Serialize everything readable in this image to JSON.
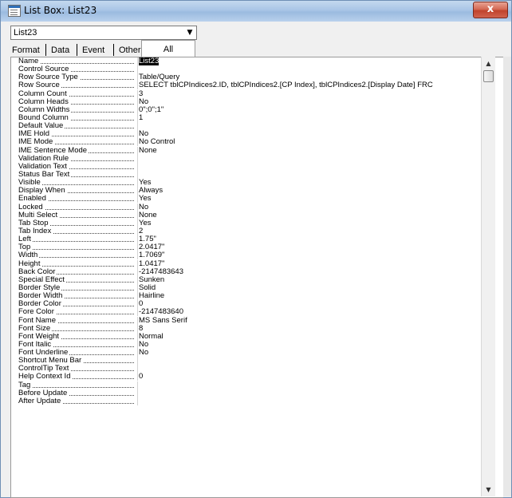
{
  "window": {
    "title": "List Box: List23",
    "close_glyph": "x"
  },
  "selector": {
    "value": "List23",
    "arrow_glyph": "▼"
  },
  "tabs": [
    {
      "label": "Format"
    },
    {
      "label": "Data"
    },
    {
      "label": "Event"
    },
    {
      "label": "Other"
    },
    {
      "label": "All",
      "active": true
    }
  ],
  "properties": [
    {
      "name": "Name",
      "value": "List23",
      "selected": true
    },
    {
      "name": "Control Source",
      "value": ""
    },
    {
      "name": "Row Source Type",
      "value": "Table/Query"
    },
    {
      "name": "Row Source",
      "value": "SELECT tblCPIndices2.ID, tblCPIndices2.[CP Index], tblCPIndices2.[Display Date] FRC"
    },
    {
      "name": "Column Count",
      "value": "3"
    },
    {
      "name": "Column Heads",
      "value": "No"
    },
    {
      "name": "Column Widths",
      "value": "0\";0\";1\""
    },
    {
      "name": "Bound Column",
      "value": "1"
    },
    {
      "name": "Default Value",
      "value": ""
    },
    {
      "name": "IME Hold",
      "value": "No"
    },
    {
      "name": "IME Mode",
      "value": "No Control"
    },
    {
      "name": "IME Sentence Mode",
      "value": "None"
    },
    {
      "name": "Validation Rule",
      "value": ""
    },
    {
      "name": "Validation Text",
      "value": ""
    },
    {
      "name": "Status Bar Text",
      "value": ""
    },
    {
      "name": "Visible",
      "value": "Yes"
    },
    {
      "name": "Display When",
      "value": "Always"
    },
    {
      "name": "Enabled",
      "value": "Yes"
    },
    {
      "name": "Locked",
      "value": "No"
    },
    {
      "name": "Multi Select",
      "value": "None"
    },
    {
      "name": "Tab Stop",
      "value": "Yes"
    },
    {
      "name": "Tab Index",
      "value": "2"
    },
    {
      "name": "Left",
      "value": "1.75\""
    },
    {
      "name": "Top",
      "value": "2.0417\""
    },
    {
      "name": "Width",
      "value": "1.7069\""
    },
    {
      "name": "Height",
      "value": "1.0417\""
    },
    {
      "name": "Back Color",
      "value": "-2147483643"
    },
    {
      "name": "Special Effect",
      "value": "Sunken"
    },
    {
      "name": "Border Style",
      "value": "Solid"
    },
    {
      "name": "Border Width",
      "value": "Hairline"
    },
    {
      "name": "Border Color",
      "value": "0"
    },
    {
      "name": "Fore Color",
      "value": "-2147483640"
    },
    {
      "name": "Font Name",
      "value": "MS Sans Serif"
    },
    {
      "name": "Font Size",
      "value": "8"
    },
    {
      "name": "Font Weight",
      "value": "Normal"
    },
    {
      "name": "Font Italic",
      "value": "No"
    },
    {
      "name": "Font Underline",
      "value": "No"
    },
    {
      "name": "Shortcut Menu Bar",
      "value": ""
    },
    {
      "name": "ControlTip Text",
      "value": ""
    },
    {
      "name": "Help Context Id",
      "value": "0"
    },
    {
      "name": "Tag",
      "value": ""
    },
    {
      "name": "Before Update",
      "value": ""
    },
    {
      "name": "After Update",
      "value": ""
    }
  ],
  "scrollbar": {
    "up_glyph": "▲",
    "down_glyph": "▼"
  }
}
